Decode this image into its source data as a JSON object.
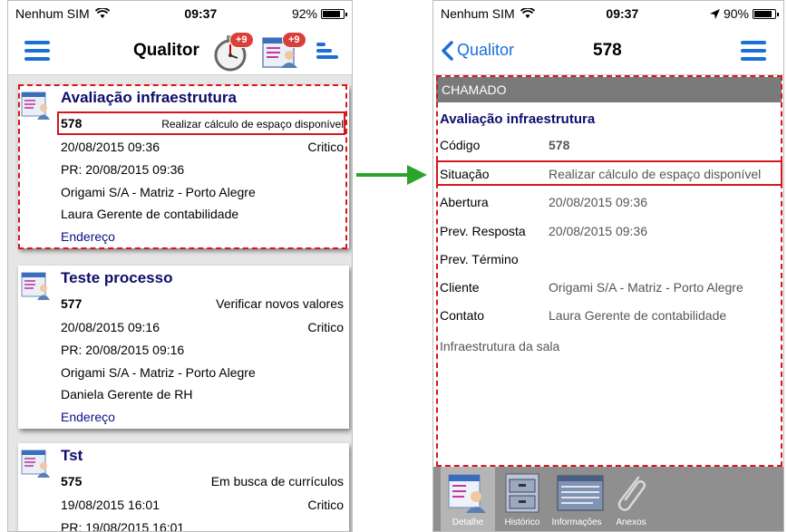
{
  "left": {
    "status": {
      "carrier": "Nenhum SIM",
      "time": "09:37",
      "battery": "92%",
      "battery_level": 0.92
    },
    "nav": {
      "title": "Qualitor",
      "badge_1": "+9",
      "badge_2": "+9"
    },
    "cards": [
      {
        "title": "Avaliação infraestrutura",
        "number": "578",
        "situation": "Realizar cálculo de espaço disponível",
        "date": "20/08/2015 09:36",
        "priority": "Critico",
        "pr": "PR: 20/08/2015 09:36",
        "client": "Origami S/A - Matriz - Porto Alegre",
        "contact": "Laura Gerente de contabilidade",
        "link": "Endereço"
      },
      {
        "title": "Teste processo",
        "number": "577",
        "situation": "Verificar novos valores",
        "date": "20/08/2015 09:16",
        "priority": "Critico",
        "pr": "PR: 20/08/2015 09:16",
        "client": "Origami S/A - Matriz - Porto Alegre",
        "contact": "Daniela Gerente de RH",
        "link": "Endereço"
      },
      {
        "title": "Tst",
        "number": "575",
        "situation": "Em busca de currículos",
        "date": "19/08/2015 16:01",
        "priority": "Critico",
        "pr": "PR: 19/08/2015 16:01"
      }
    ]
  },
  "right": {
    "status": {
      "carrier": "Nenhum SIM",
      "time": "09:37",
      "battery": "90%",
      "battery_level": 0.9
    },
    "nav": {
      "back_label": "Qualitor",
      "title": "578"
    },
    "section": "CHAMADO",
    "title": "Avaliação infraestrutura",
    "fields": [
      {
        "label": "Código",
        "value": "578"
      },
      {
        "label": "Situação",
        "value": "Realizar cálculo de espaço disponível"
      },
      {
        "label": "Abertura",
        "value": "20/08/2015 09:36"
      },
      {
        "label": "Prev. Resposta",
        "value": "20/08/2015 09:36"
      },
      {
        "label": "Prev. Término",
        "value": ""
      },
      {
        "label": "Cliente",
        "value": "Origami S/A - Matriz - Porto Alegre"
      },
      {
        "label": "Contato",
        "value": "Laura Gerente de contabilidade"
      }
    ],
    "description": "Infraestrutura da sala",
    "tabs": [
      "Detalhe",
      "Histórico",
      "Informações",
      "Anexos"
    ]
  },
  "colors": {
    "accent": "#1a6fd8",
    "highlight": "#d8151d",
    "arrow": "#2aa52a",
    "title": "#0d0d6b"
  }
}
